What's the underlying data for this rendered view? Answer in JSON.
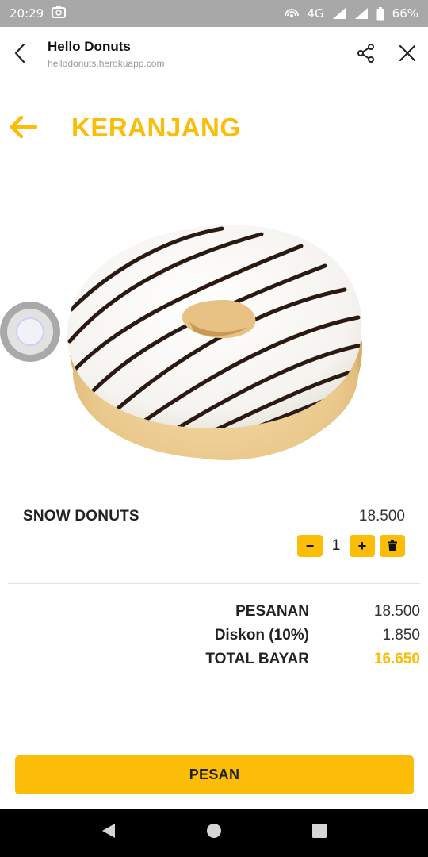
{
  "status_bar": {
    "time": "20:29",
    "network": "4G",
    "battery": "66%"
  },
  "browser_bar": {
    "title": "Hello Donuts",
    "url": "hellodonuts.herokuapp.com"
  },
  "page": {
    "title": "KERANJANG"
  },
  "cart_item": {
    "name": "SNOW DONUTS",
    "price": "18.500",
    "quantity": "1",
    "minus_label": "−",
    "plus_label": "+"
  },
  "summary": {
    "rows": [
      {
        "label": "PESANAN",
        "value": "18.500"
      },
      {
        "label": "Diskon (10%)",
        "value": "1.850"
      },
      {
        "label": "TOTAL BAYAR",
        "value": "16.650"
      }
    ]
  },
  "order_button": {
    "label": "PESAN"
  },
  "colors": {
    "accent": "#fbbd08",
    "status_bar": "#a8a8a8",
    "nav_bar": "#000000"
  },
  "icons": {
    "back": "chevron-left-icon",
    "share": "share-icon",
    "close": "close-icon",
    "arrow_back": "arrow-left-icon",
    "delete": "trash-icon"
  }
}
